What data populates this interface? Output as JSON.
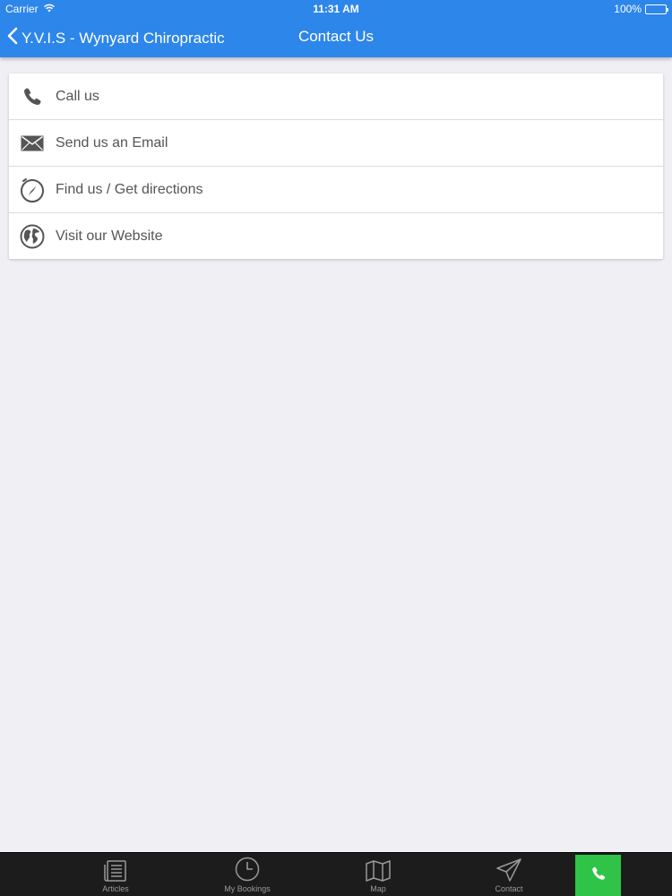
{
  "status_bar": {
    "carrier": "Carrier",
    "time": "11:31 AM",
    "battery": "100%"
  },
  "nav": {
    "back_label": "Y.V.I.S - Wynyard Chiropractic",
    "title": "Contact Us"
  },
  "contact_items": [
    {
      "label": "Call us",
      "icon": "phone-icon"
    },
    {
      "label": "Send us an Email",
      "icon": "envelope-icon"
    },
    {
      "label": "Find us / Get directions",
      "icon": "compass-icon"
    },
    {
      "label": "Visit our Website",
      "icon": "globe-icon"
    }
  ],
  "tabs": [
    {
      "label": "Articles",
      "icon": "articles-icon"
    },
    {
      "label": "My Bookings",
      "icon": "clock-icon"
    },
    {
      "label": "Map",
      "icon": "map-icon"
    },
    {
      "label": "Contact",
      "icon": "paper-plane-icon"
    }
  ],
  "colors": {
    "nav_blue": "#2d86ea",
    "background": "#efeff4",
    "tabbar": "#1c1c1c",
    "call_green": "#2fc347"
  }
}
